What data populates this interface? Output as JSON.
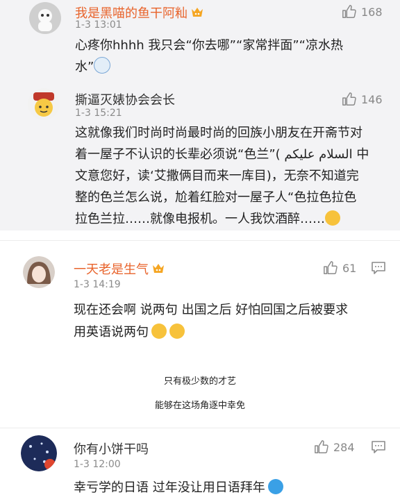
{
  "comments": [
    {
      "username": "我是黑喵的鱼干阿籼",
      "time": "1-3 13:01",
      "likes": "168",
      "lines": [
        "心疼你hhhh 我只会“你去哪”“家常拌面”“凉水热",
        "水”"
      ]
    },
    {
      "username": "撕逼灭婊协会会长",
      "time": "1-3 15:21",
      "likes": "146",
      "lines": [
        "这就像我们时尚时尚最时尚的回族小朋友在开斋节对",
        "着一屋子不认识的长辈必须说“色兰”( السلام عليكم 中",
        "文意您好，读‘艾撒俩目而来一库目)，无奈不知道完",
        "整的色兰怎么说，尬着红脸对一屋子人“色拉色拉色",
        "拉色兰拉……就像电报机。一人我饮酒醉……"
      ]
    },
    {
      "username": "一天老是生气",
      "time": "1-3 14:19",
      "likes": "61",
      "lines": [
        "现在还会啊 说两句 出国之后 好怕回国之后被要求",
        "用英语说两句"
      ]
    },
    {
      "username": "你有小饼干吗",
      "time": "1-3 12:00",
      "likes": "284",
      "lines": [
        "幸亏学的日语 过年没让用日语拜年"
      ]
    }
  ],
  "captions": [
    "只有极少数的才艺",
    "能够在这场角逐中幸免"
  ],
  "colors": {
    "username_orange": "#e8632b",
    "gray_bg": "#f3f3f5",
    "time": "#8a8a8a"
  }
}
